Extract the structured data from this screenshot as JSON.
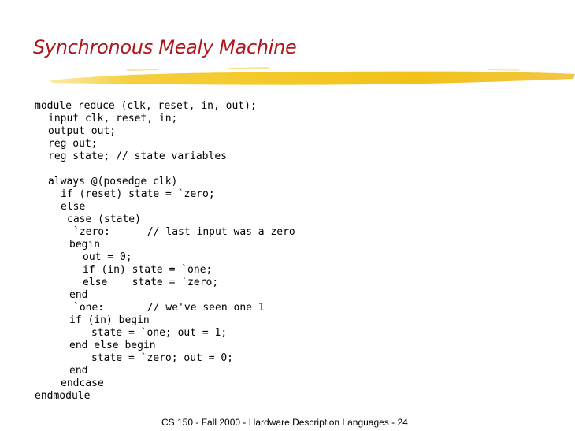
{
  "slide": {
    "title": "Synchronous Mealy Machine",
    "accent_color": "#b0161d",
    "underline_color": "#f2c21a",
    "code_lines": [
      "module reduce (clk, reset, in, out);",
      "input clk, reset, in;",
      "output out;",
      "reg out;",
      "reg state; // state variables",
      "",
      "always @(posedge clk)",
      "if (reset) state = `zero;",
      "else",
      "case (state)",
      "`zero:      // last input was a zero",
      "begin",
      "out = 0;",
      "if (in) state = `one;",
      "else    state = `zero;",
      "end",
      "`one:       // we've seen one 1",
      "if (in) begin",
      "state = `one; out = 1;",
      "end else begin",
      "state = `zero; out = 0;",
      "end",
      "endcase",
      "endmodule"
    ],
    "footer": "CS 150 - Fall 2000 - Hardware Description Languages - 24"
  }
}
